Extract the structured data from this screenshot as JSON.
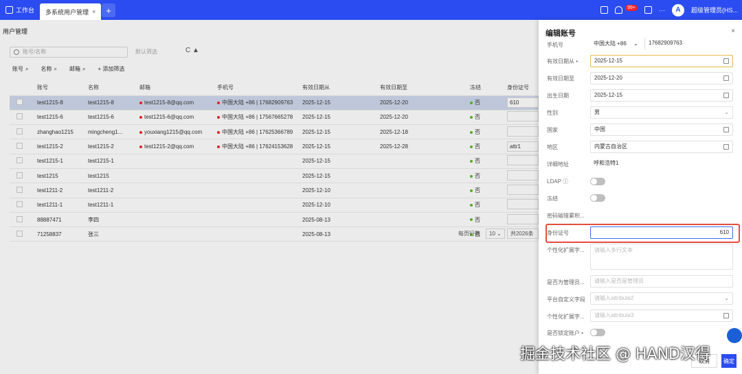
{
  "topbar": {
    "home_label": "工作台",
    "active_tab": "多系统用户管理",
    "tab_close": "×",
    "add": "+",
    "badge": "99+",
    "more": "···",
    "user": "超级管理员(HS..."
  },
  "page": {
    "title": "用户管理",
    "search_placeholder": "账号/名称",
    "filter_placeholder": "默认筛选",
    "refresh": "C ▲",
    "filter_cols": [
      "账号",
      "名称",
      "邮箱"
    ],
    "add_filter": "+ 添加筛选"
  },
  "table": {
    "headers": [
      "",
      "账号",
      "名称",
      "邮箱",
      "手机号",
      "有效日期从",
      "有效日期至",
      "冻结",
      "身份证号"
    ],
    "rows": [
      {
        "account": "test1215-8",
        "name": "test1215-8",
        "email": "test1215-8@qq.com",
        "phone": "中国大陆 +86 | 17682909763",
        "from": "2025-12-15",
        "to": "2025-12-20",
        "frozen": "否",
        "id": "610",
        "selected": true
      },
      {
        "account": "test1215-6",
        "name": "test1215-6",
        "email": "test1215-6@qq.com",
        "phone": "中国大陆 +86 | 17567665278",
        "from": "2025-12-15",
        "to": "2025-12-20",
        "frozen": "否",
        "id": "",
        "selected": false
      },
      {
        "account": "zhanghao1215",
        "name": "mingcheng1...",
        "email": "youxiang1215@qq.com",
        "phone": "中国大陆 +86 | 17625366789",
        "from": "2025-12-15",
        "to": "2025-12-18",
        "frozen": "否",
        "id": "",
        "selected": false
      },
      {
        "account": "test1215-2",
        "name": "test1215-2",
        "email": "test1215-2@qq.com",
        "phone": "中国大陆 +86 | 17624153628",
        "from": "2025-12-15",
        "to": "2025-12-28",
        "frozen": "否",
        "id": "attr1",
        "selected": false
      },
      {
        "account": "test1215-1",
        "name": "test1215-1",
        "email": "",
        "phone": "",
        "from": "2025-12-15",
        "to": "",
        "frozen": "否",
        "id": "",
        "selected": false
      },
      {
        "account": "test1215",
        "name": "test1215",
        "email": "",
        "phone": "",
        "from": "2025-12-15",
        "to": "",
        "frozen": "否",
        "id": "",
        "selected": false
      },
      {
        "account": "test1211-2",
        "name": "test1211-2",
        "email": "",
        "phone": "",
        "from": "2025-12-10",
        "to": "",
        "frozen": "否",
        "id": "",
        "selected": false
      },
      {
        "account": "test1211-1",
        "name": "test1211-1",
        "email": "",
        "phone": "",
        "from": "2025-12-10",
        "to": "",
        "frozen": "否",
        "id": "",
        "selected": false
      },
      {
        "account": "88887471",
        "name": "李四",
        "email": "",
        "phone": "",
        "from": "2025-08-13",
        "to": "",
        "frozen": "否",
        "id": "",
        "selected": false
      },
      {
        "account": "71258837",
        "name": "张三",
        "email": "",
        "phone": "",
        "from": "2025-08-13",
        "to": "",
        "frozen": "否",
        "id": "",
        "selected": false
      }
    ]
  },
  "pager": {
    "per_page_label": "每页行数",
    "per_page": "10 ⌄",
    "total": "共2026条"
  },
  "drawer": {
    "title": "编辑账号",
    "close": "×",
    "fields": {
      "phone_label": "手机号",
      "phone_region": "中国大陆 +86",
      "phone_arrow": "⌄",
      "phone_value": "17682909763",
      "from_label": "有效日期从 •",
      "from_value": "2025-12-15",
      "to_label": "有效日期至",
      "to_value": "2025-12-20",
      "birth_label": "出生日期",
      "birth_value": "2025-12-15",
      "gender_label": "性别",
      "gender_value": "男",
      "gender_arrow": "⌄",
      "country_label": "国家",
      "country_value": "中国",
      "region_label": "地区",
      "region_value": "内蒙古自治区",
      "address_label": "详细地址",
      "address_value": "呼和浩特1",
      "ldap_label": "LDAP ⓘ",
      "frozen_label": "冻结",
      "pwd_label": "密码输错累积...",
      "id_label": "身份证号",
      "id_value": "610",
      "ext1_label": "个性化扩展字...",
      "ext1_placeholder": "请输入多行文本",
      "admin_label": "是否为管理员...",
      "admin_placeholder": "请输入是否是管理员",
      "platform_label": "平台自定义字段",
      "platform_placeholder": "请输入attribute2",
      "platform_arrow": "⌄",
      "ext2_label": "个性化扩展字...",
      "ext2_placeholder": "请输入attribute3",
      "lock_label": "是否锁定账户 •"
    },
    "cancel": "取消",
    "ok": "确定"
  },
  "watermark": "掘金技术社区 @ HAND汉得"
}
